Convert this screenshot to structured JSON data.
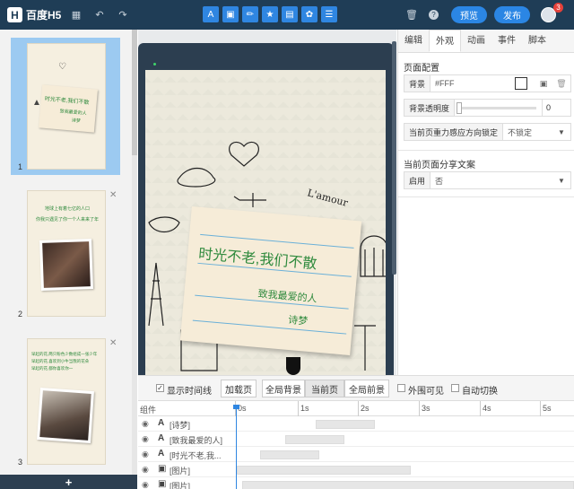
{
  "app": {
    "name": "百度H5"
  },
  "toolbar": {
    "preview_label": "预览",
    "publish_label": "发布",
    "notification_count": "3",
    "tools": [
      "text-tool-icon",
      "image-tool-icon",
      "brush-tool-icon",
      "star-tool-icon",
      "chart-tool-icon",
      "effects-tool-icon",
      "list-tool-icon"
    ]
  },
  "pages": [
    {
      "number": "1",
      "title": "时光不老,我们不散",
      "line2": "致我最爱的人",
      "line3": "诗梦"
    },
    {
      "number": "2",
      "text1": "地球上有着七亿的人口",
      "text2": "你我只遇见了你一个人来来了年"
    },
    {
      "number": "3",
      "text1": "早起的花,两只粉色少数组成一张少年",
      "text2": "早起的花,喜欢到小牛当我的花朵",
      "text3": "早起的花,都你喜欢你一"
    }
  ],
  "add_page_label": "+",
  "canvas": {
    "title": "时光不老,我们不散",
    "subtitle": "致我最爱的人",
    "signature": "诗梦",
    "sign_text": "L'amour"
  },
  "props": {
    "tabs": [
      "编辑",
      "外观",
      "动画",
      "事件",
      "脚本"
    ],
    "active_tab": "外观",
    "page_config_title": "页面配置",
    "bg_label": "背景",
    "bg_value": "#FFF",
    "opacity_label": "背景透明度",
    "opacity_value": "0",
    "lock_label": "当前页重力感应方向锁定",
    "lock_value": "不锁定",
    "share_title": "当前页面分享文案",
    "share_enable_label": "启用",
    "share_enable_value": "否"
  },
  "timeline": {
    "show_time_label": "显示时间线",
    "buttons": [
      "加载页",
      "全局背景",
      "当前页",
      "全局前景"
    ],
    "active_button": "当前页",
    "outside_visible_label": "外围可见",
    "auto_switch_label": "自动切换",
    "component_header": "组件",
    "ticks": [
      "0s",
      "1s",
      "2s",
      "3s",
      "4s",
      "5s"
    ],
    "rows": [
      {
        "type": "A",
        "name": "[诗梦]"
      },
      {
        "type": "A",
        "name": "[致我最爱的人]"
      },
      {
        "type": "A",
        "name": "[时光不老,我..."
      },
      {
        "type": "img",
        "name": "[图片]"
      },
      {
        "type": "img",
        "name": "[图片]"
      }
    ]
  }
}
